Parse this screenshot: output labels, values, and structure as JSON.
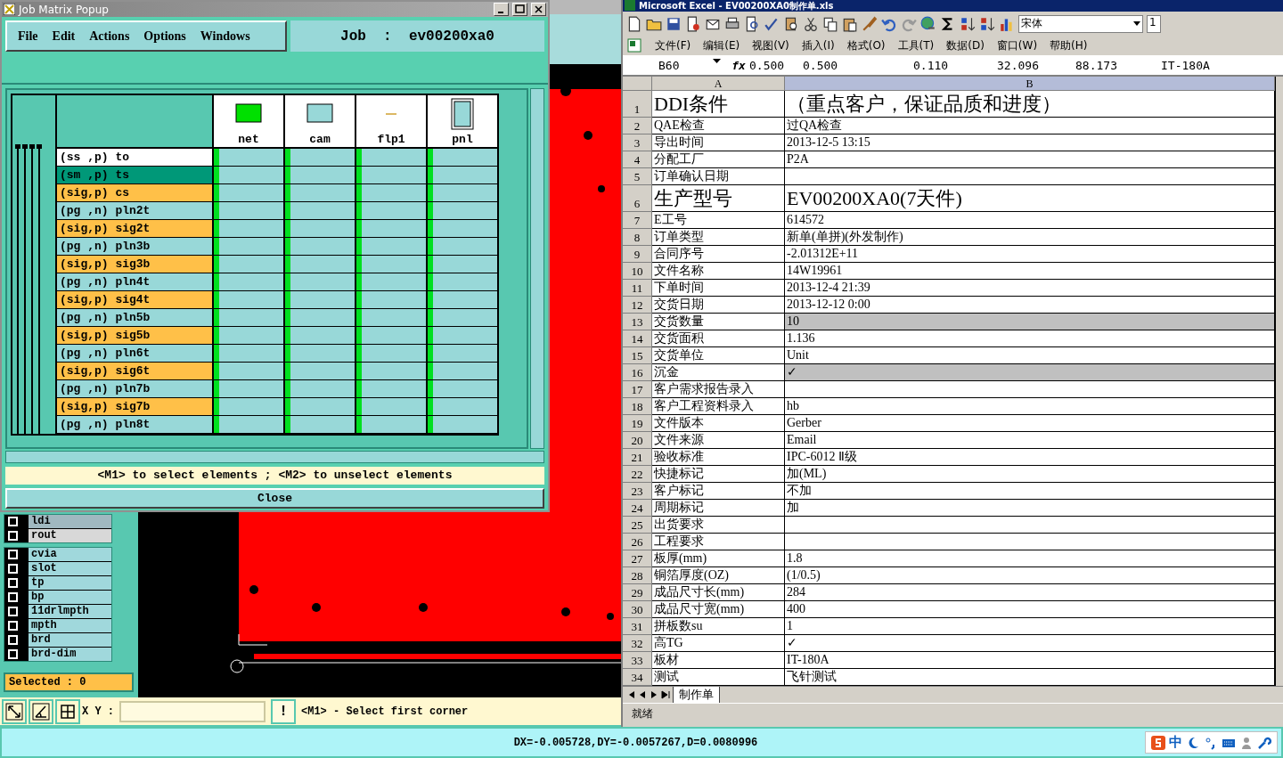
{
  "cam": {
    "layer_groups": [
      [
        {
          "name": "ldi",
          "kind": "dim",
          "checked": false
        },
        {
          "name": "rout",
          "kind": "rout",
          "checked": false
        }
      ],
      [
        {
          "name": "cvia",
          "kind": "board",
          "checked": false
        },
        {
          "name": "slot",
          "kind": "board",
          "checked": false
        },
        {
          "name": "tp",
          "kind": "board",
          "checked": false
        },
        {
          "name": "bp",
          "kind": "board",
          "checked": false
        },
        {
          "name": "11drlmpth",
          "kind": "board",
          "checked": false
        },
        {
          "name": "mpth",
          "kind": "board",
          "checked": false
        },
        {
          "name": "brd",
          "kind": "board",
          "checked": false
        },
        {
          "name": "brd-dim",
          "kind": "board",
          "checked": false
        }
      ]
    ],
    "selected_count": "Selected : 0",
    "xy_label": "X Y :",
    "alert_button": "!",
    "prompt": "<M1> - Select first corner"
  },
  "popup": {
    "title": "Job Matrix Popup",
    "menu": [
      "File",
      "Edit",
      "Actions",
      "Options",
      "Windows"
    ],
    "job_label": "Job  :  ev00200xa0",
    "columns": [
      {
        "name": "net",
        "kind": "net"
      },
      {
        "name": "cam",
        "kind": "cam"
      },
      {
        "name": "flp1",
        "kind": "flip"
      },
      {
        "name": "pnl",
        "kind": "panel"
      }
    ],
    "rows": [
      {
        "label": "(ss ,p) to",
        "color": "#ffffff"
      },
      {
        "label": "(sm ,p) ts",
        "color": "#009878"
      },
      {
        "label": "(sig,p) cs",
        "color": "#ffc048"
      },
      {
        "label": "(pg ,n) pln2t",
        "color": "#98d8d8"
      },
      {
        "label": "(sig,p) sig2t",
        "color": "#ffc048"
      },
      {
        "label": "(pg ,n) pln3b",
        "color": "#98d8d8"
      },
      {
        "label": "(sig,p) sig3b",
        "color": "#ffc048"
      },
      {
        "label": "(pg ,n) pln4t",
        "color": "#98d8d8"
      },
      {
        "label": "(sig,p) sig4t",
        "color": "#ffc048"
      },
      {
        "label": "(pg ,n) pln5b",
        "color": "#98d8d8"
      },
      {
        "label": "(sig,p) sig5b",
        "color": "#ffc048"
      },
      {
        "label": "(pg ,n) pln6t",
        "color": "#98d8d8"
      },
      {
        "label": "(sig,p) sig6t",
        "color": "#ffc048"
      },
      {
        "label": "(pg ,n) pln7b",
        "color": "#98d8d8"
      },
      {
        "label": "(sig,p) sig7b",
        "color": "#ffc048"
      },
      {
        "label": "(pg ,n) pln8t",
        "color": "#98d8d8"
      }
    ],
    "hint": "<M1> to select elements ; <M2> to unselect elements",
    "close": "Close"
  },
  "excel": {
    "title": "Microsoft Excel - EV00200XA0制作单.xls",
    "font_name": "宋体",
    "font_size": "1",
    "menu": [
      "文件(F)",
      "编辑(E)",
      "视图(V)",
      "插入(I)",
      "格式(O)",
      "工具(T)",
      "数据(D)",
      "窗口(W)",
      "帮助(H)"
    ],
    "name_box": "B60",
    "formula_label": "fx",
    "formula_values": [
      "0.500",
      "0.500",
      "0.110",
      "32.096",
      "88.173",
      "IT-180A"
    ],
    "columns": [
      "A",
      "B"
    ],
    "rows": [
      {
        "n": "1",
        "a": "DDI条件",
        "b": "（重点客户，保证品质和进度）",
        "kind": "heading",
        "shaded": false
      },
      {
        "n": "2",
        "a": "QAE检查",
        "b": "过QA检查",
        "kind": "normal",
        "shaded": false
      },
      {
        "n": "3",
        "a": "导出时间",
        "b": "2013-12-5 13:15",
        "kind": "normal",
        "shaded": false
      },
      {
        "n": "4",
        "a": "分配工厂",
        "b": "P2A",
        "kind": "normal",
        "shaded": false
      },
      {
        "n": "5",
        "a": "订单确认日期",
        "kind": "normal",
        "shaded": false
      },
      {
        "n": "6",
        "a": "生产型号",
        "b": "EV00200XA0(7天件)",
        "kind": "heading",
        "shaded": false
      },
      {
        "n": "7",
        "a": "E工号",
        "b": "614572",
        "kind": "normal",
        "shaded": false
      },
      {
        "n": "8",
        "a": "订单类型",
        "b": "新单(单拼)(外发制作)",
        "kind": "normal",
        "shaded": false
      },
      {
        "n": "9",
        "a": "合同序号",
        "b": "-2.01312E+11",
        "kind": "normal",
        "shaded": false
      },
      {
        "n": "10",
        "a": "文件名称",
        "b": "14W19961",
        "kind": "normal",
        "shaded": false
      },
      {
        "n": "11",
        "a": "下单时间",
        "b": "2013-12-4 21:39",
        "kind": "normal",
        "shaded": false
      },
      {
        "n": "12",
        "a": "交货日期",
        "b": "2013-12-12 0:00",
        "kind": "normal",
        "shaded": false
      },
      {
        "n": "13",
        "a": "交货数量",
        "b": "10",
        "kind": "normal",
        "shaded": true
      },
      {
        "n": "14",
        "a": "交货面积",
        "b": "1.136",
        "kind": "normal",
        "shaded": false
      },
      {
        "n": "15",
        "a": "交货单位",
        "b": "Unit",
        "kind": "normal",
        "shaded": false
      },
      {
        "n": "16",
        "a": "沉金",
        "b": "✓",
        "kind": "normal",
        "shaded": true
      },
      {
        "n": "17",
        "a": "客户需求报告录入",
        "kind": "normal",
        "shaded": false
      },
      {
        "n": "18",
        "a": "客户工程资料录入",
        "b": "hb",
        "kind": "normal",
        "shaded": false
      },
      {
        "n": "19",
        "a": "文件版本",
        "b": "Gerber",
        "kind": "normal",
        "shaded": false
      },
      {
        "n": "20",
        "a": "文件来源",
        "b": "Email",
        "kind": "normal",
        "shaded": false
      },
      {
        "n": "21",
        "a": "验收标准",
        "b": "IPC-6012 Ⅱ级",
        "kind": "normal",
        "shaded": false
      },
      {
        "n": "22",
        "a": "快捷标记",
        "b": "加(ML)",
        "kind": "normal",
        "shaded": false
      },
      {
        "n": "23",
        "a": "客户标记",
        "b": "不加",
        "kind": "normal",
        "shaded": false
      },
      {
        "n": "24",
        "a": "周期标记",
        "b": "加",
        "kind": "normal",
        "shaded": false
      },
      {
        "n": "25",
        "a": "出货要求",
        "kind": "normal",
        "shaded": false
      },
      {
        "n": "26",
        "a": "工程要求",
        "kind": "normal",
        "shaded": false
      },
      {
        "n": "27",
        "a": "板厚(mm)",
        "b": "1.8",
        "kind": "normal",
        "shaded": false
      },
      {
        "n": "28",
        "a": "铜箔厚度(OZ)",
        "b": "(1/0.5)",
        "kind": "normal",
        "shaded": false
      },
      {
        "n": "29",
        "a": "成品尺寸长(mm)",
        "b": "284",
        "kind": "normal",
        "shaded": false
      },
      {
        "n": "30",
        "a": "成品尺寸宽(mm)",
        "b": "400",
        "kind": "normal",
        "shaded": false
      },
      {
        "n": "31",
        "a": "拼板数su",
        "b": "1",
        "kind": "normal",
        "shaded": false
      },
      {
        "n": "32",
        "a": "高TG",
        "b": "✓",
        "kind": "normal",
        "shaded": false
      },
      {
        "n": "33",
        "a": "板材",
        "b": "IT-180A",
        "kind": "normal",
        "shaded": false
      },
      {
        "n": "34",
        "a": "测试",
        "b": "飞针测试",
        "kind": "normal",
        "shaded": false
      }
    ],
    "sheet_tabs": [
      {
        "label": "制作单",
        "selected": true
      }
    ],
    "status": "就绪"
  },
  "status_bar": {
    "text": "DX=-0.005728,DY=-0.0057267,D=0.0080996",
    "ime_mode": "中"
  }
}
